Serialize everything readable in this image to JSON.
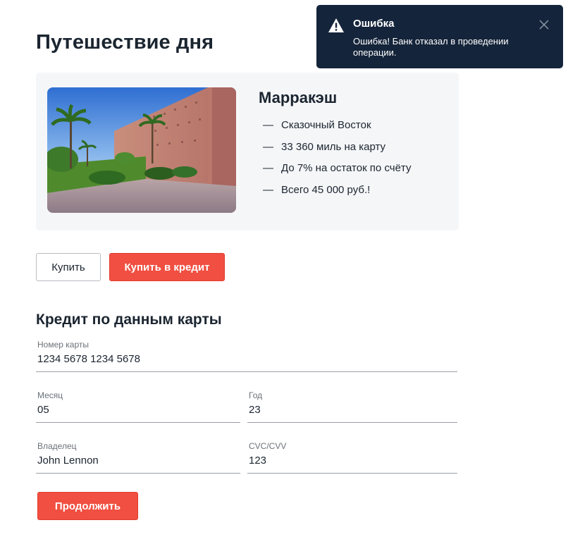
{
  "page": {
    "title": "Путешествие дня"
  },
  "offer": {
    "city": "Марракэш",
    "features": [
      "Сказочный Восток",
      "33 360 миль на карту",
      "До 7% на остаток по счёту",
      "Всего 45 000 руб.!"
    ],
    "dash": "—"
  },
  "actions": {
    "buy_label": "Купить",
    "credit_label": "Купить в кредит"
  },
  "credit_form": {
    "title": "Кредит по данным карты",
    "card_number": {
      "label": "Номер карты",
      "value": "1234 5678 1234 5678"
    },
    "month": {
      "label": "Месяц",
      "value": "05"
    },
    "year": {
      "label": "Год",
      "value": "23"
    },
    "owner": {
      "label": "Владелец",
      "value": "John Lennon"
    },
    "cvc": {
      "label": "CVC/CVV",
      "value": "123"
    },
    "continue_label": "Продолжить"
  },
  "notification": {
    "title": "Ошибка",
    "message": "Ошибка! Банк отказал в проведении операции.",
    "icon": "warning-icon",
    "close_icon": "close-icon"
  },
  "colors": {
    "accent": "#f04f41",
    "text": "#1b2530",
    "card_bg": "#f5f6f8",
    "toast_bg": "#14243a"
  }
}
